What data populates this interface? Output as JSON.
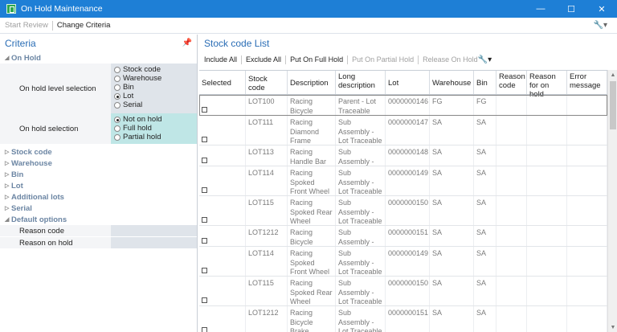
{
  "window": {
    "title": "On Hold Maintenance"
  },
  "toolbar": {
    "start_review": "Start Review",
    "change_criteria": "Change Criteria"
  },
  "criteria": {
    "title": "Criteria",
    "on_hold_section": "On Hold",
    "level_label": "On hold level selection",
    "level_options": [
      "Stock code",
      "Warehouse",
      "Bin",
      "Lot",
      "Serial"
    ],
    "level_selected": "Lot",
    "selection_label": "On hold selection",
    "selection_options": [
      "Not on hold",
      "Full hold",
      "Partial hold"
    ],
    "selection_selected": "Not on hold",
    "sections": [
      "Stock code",
      "Warehouse",
      "Bin",
      "Lot",
      "Additional lots",
      "Serial"
    ],
    "default_options": "Default options",
    "reason_code_label": "Reason code",
    "reason_on_hold_label": "Reason on hold"
  },
  "list": {
    "title": "Stock code List",
    "actions": {
      "include_all": "Include All",
      "exclude_all": "Exclude All",
      "put_full": "Put On Full Hold",
      "put_partial": "Put On Partial Hold",
      "release": "Release On Hold"
    },
    "columns": [
      "Selected",
      "Stock code",
      "Description",
      "Long description",
      "Lot",
      "Warehouse",
      "Bin",
      "Reason code",
      "Reason for on hold",
      "Error message"
    ],
    "rows": [
      {
        "stock": "LOT100",
        "desc": "Racing Bicycle",
        "long": "Parent - Lot Traceable",
        "lot": "0000000146",
        "wh": "FG",
        "bin": "FG"
      },
      {
        "stock": "LOT111",
        "desc": "Racing Diamond Frame",
        "long": "Sub Assembly - Lot Traceable",
        "lot": "0000000147",
        "wh": "SA",
        "bin": "SA"
      },
      {
        "stock": "LOT113",
        "desc": "Racing Handle Bar Assembly",
        "long": "Sub Assembly - Lot Traceable",
        "lot": "0000000148",
        "wh": "SA",
        "bin": "SA"
      },
      {
        "stock": "LOT114",
        "desc": "Racing Spoked Front Wheel",
        "long": "Sub Assembly - Lot Traceable",
        "lot": "0000000149",
        "wh": "SA",
        "bin": "SA"
      },
      {
        "stock": "LOT115",
        "desc": "Racing Spoked Rear Wheel",
        "long": "Sub Assembly - Lot Traceable",
        "lot": "0000000150",
        "wh": "SA",
        "bin": "SA"
      },
      {
        "stock": "LOT1212",
        "desc": "Racing Bicycle Brake",
        "long": "Sub Assembly - Lot Traceable",
        "lot": "0000000151",
        "wh": "SA",
        "bin": "SA"
      },
      {
        "stock": "LOT114",
        "desc": "Racing Spoked Front Wheel",
        "long": "Sub Assembly - Lot Traceable",
        "lot": "0000000149",
        "wh": "SA",
        "bin": "SA"
      },
      {
        "stock": "LOT115",
        "desc": "Racing Spoked Rear Wheel",
        "long": "Sub Assembly - Lot Traceable",
        "lot": "0000000150",
        "wh": "SA",
        "bin": "SA"
      },
      {
        "stock": "LOT1212",
        "desc": "Racing Bicycle Brake",
        "long": "Sub Assembly - Lot Traceable",
        "lot": "0000000151",
        "wh": "SA",
        "bin": "SA"
      }
    ]
  },
  "icons": {
    "app": "app-icon",
    "pin": "pin-icon",
    "settings": "wrench-icon"
  },
  "colors": {
    "titlebar": "#1e7fd6",
    "accent": "#2a6db5",
    "highlight": "#bfe6e6"
  }
}
